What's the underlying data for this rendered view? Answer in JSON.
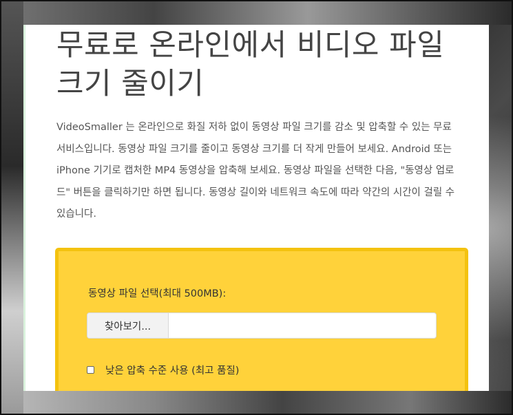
{
  "page": {
    "title": "무료로 온라인에서 비디오 파일 크기 줄이기",
    "description": "VideoSmaller 는 온라인으로 화질 저하 없이 동영상 파일 크기를 감소 및 압축할 수 있는 무료 서비스입니다. 동영상 파일 크기를 줄이고 동영상 크기를 더 작게 만들어 보세요. Android 또는 iPhone 기기로 캡처한 MP4 동영상을 압축해 보세요. 동영상 파일을 선택한 다음, \"동영상 업로드\" 버튼을 클릭하기만 하면 됩니다. 동영상 길이와 네트워크 속도에 따라 약간의 시간이 걸릴 수 있습니다."
  },
  "upload": {
    "label": "동영상 파일 선택(최대 500MB):",
    "browse_label": "찾아보기...",
    "file_name": "",
    "low_compression_label": "낮은 압축 수준 사용 (최고 품질)",
    "low_compression_checked": false
  },
  "colors": {
    "upload_box_bg": "#ffd23a",
    "upload_box_border": "#f4c20f",
    "title_text": "#444444"
  }
}
